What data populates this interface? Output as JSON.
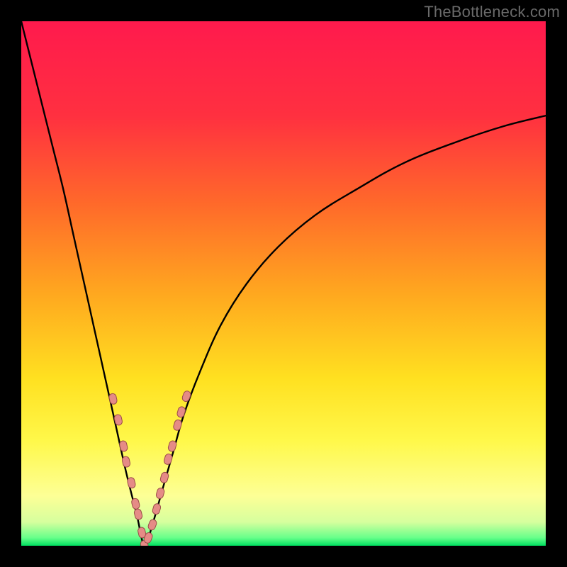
{
  "watermark": "TheBottleneck.com",
  "colors": {
    "bg_black": "#000000",
    "gradient_stops": [
      {
        "offset": 0.0,
        "color": "#ff1a4d"
      },
      {
        "offset": 0.18,
        "color": "#ff3040"
      },
      {
        "offset": 0.35,
        "color": "#ff6a2a"
      },
      {
        "offset": 0.52,
        "color": "#ffa81f"
      },
      {
        "offset": 0.68,
        "color": "#ffe020"
      },
      {
        "offset": 0.8,
        "color": "#fff84a"
      },
      {
        "offset": 0.905,
        "color": "#fdff96"
      },
      {
        "offset": 0.955,
        "color": "#d6ff9e"
      },
      {
        "offset": 0.985,
        "color": "#66ff8a"
      },
      {
        "offset": 1.0,
        "color": "#00e060"
      }
    ],
    "curve": "#000000",
    "marker_fill": "#e58b86",
    "marker_stroke": "#9a4c47"
  },
  "chart_data": {
    "type": "line",
    "title": "",
    "xlabel": "",
    "ylabel": "",
    "xlim": [
      0,
      100
    ],
    "ylim": [
      0,
      100
    ],
    "grid": false,
    "note": "Axis tick labels are not rendered in the image; x represents a component ratio (0–100) and y represents bottleneck percentage (0–100). Values below are estimated from the curve shape and marker positions against the plot extents.",
    "series": [
      {
        "name": "bottleneck-curve",
        "x": [
          0,
          2,
          4,
          6,
          8,
          10,
          12,
          14,
          16,
          18,
          20,
          22,
          23.5,
          25,
          27,
          29,
          31,
          34,
          38,
          43,
          49,
          56,
          64,
          73,
          83,
          92,
          100
        ],
        "y": [
          100,
          92,
          84,
          76,
          68,
          59,
          50,
          41,
          32,
          23,
          14,
          6,
          0,
          4,
          11,
          18,
          25,
          33,
          42,
          50,
          57,
          63,
          68,
          73,
          77,
          80,
          82
        ]
      }
    ],
    "markers": {
      "name": "highlighted-points",
      "note": "Pink lozenge-shaped markers clustered near the curve minimum.",
      "x": [
        17.5,
        18.5,
        19.5,
        20.0,
        21.0,
        21.8,
        22.3,
        23.0,
        23.5,
        24.2,
        25.0,
        25.8,
        26.5,
        27.3,
        28.0,
        28.8,
        29.8,
        30.5,
        31.5
      ],
      "y": [
        28.0,
        24.0,
        19.0,
        16.0,
        12.0,
        8.0,
        6.0,
        2.5,
        0.0,
        1.5,
        4.0,
        7.0,
        10.0,
        13.0,
        16.5,
        19.0,
        23.0,
        25.5,
        28.5
      ]
    },
    "minimum": {
      "x": 23.5,
      "y": 0
    }
  }
}
